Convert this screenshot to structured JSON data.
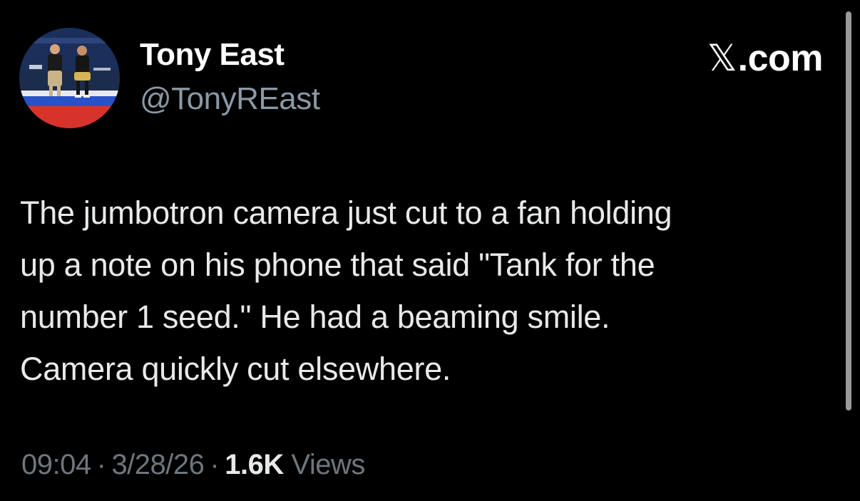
{
  "author": {
    "display_name": "Tony East",
    "handle": "@TonyREast"
  },
  "brand": {
    "logo_glyph": "𝕏",
    "text": ".com"
  },
  "tweet": {
    "text": "The jumbotron camera just cut to a fan holding\nup a note on his phone that said \"Tank for the\nnumber 1 seed.\" He had a beaming smile.\nCamera quickly cut elsewhere."
  },
  "meta": {
    "time": "09:04",
    "separator": "·",
    "date": "3/28/26",
    "views_count": "1.6K",
    "views_label": "Views"
  },
  "colors": {
    "background": "#000000",
    "primary_text": "#e7e9ea",
    "secondary_text": "#8b98a5",
    "meta_text": "#6e767d"
  }
}
